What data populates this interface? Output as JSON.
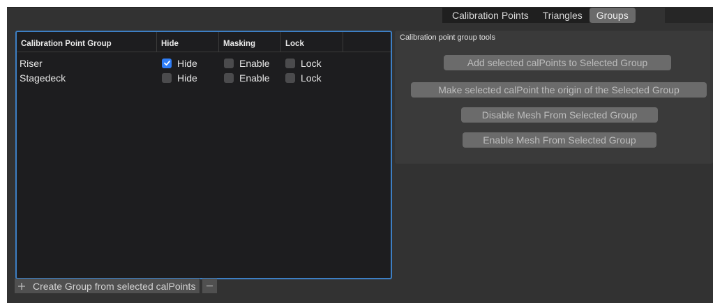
{
  "tabs": [
    {
      "label": "Calibration Points",
      "active": false
    },
    {
      "label": "Triangles",
      "active": false
    },
    {
      "label": "Groups",
      "active": true
    }
  ],
  "table": {
    "headers": [
      "Calibration Point Group",
      "Hide",
      "Masking",
      "Lock"
    ],
    "rows": [
      {
        "name": "Riser",
        "hide": {
          "label": "Hide",
          "checked": true
        },
        "masking": {
          "label": "Enable",
          "checked": false
        },
        "lock": {
          "label": "Lock",
          "checked": false
        }
      },
      {
        "name": "Stagedeck",
        "hide": {
          "label": "Hide",
          "checked": false
        },
        "masking": {
          "label": "Enable",
          "checked": false
        },
        "lock": {
          "label": "Lock",
          "checked": false
        }
      }
    ]
  },
  "bottom_toolbar": {
    "create_label": "Create Group from selected calPoints",
    "add_icon": "plus-icon",
    "remove_icon": "minus-icon"
  },
  "tools": {
    "title": "Calibration point group tools",
    "buttons": [
      "Add selected calPoints to Selected Group",
      "Make selected calPoint the origin of the Selected Group",
      "Disable Mesh From Selected Group",
      "Enable Mesh From Selected Group"
    ]
  },
  "colors": {
    "background": "#323232",
    "table_bg": "#1d1d1f",
    "focus_border": "#3d7fc4",
    "checkbox_checked": "#2f7df6",
    "button_bg": "#6b6b6b"
  }
}
